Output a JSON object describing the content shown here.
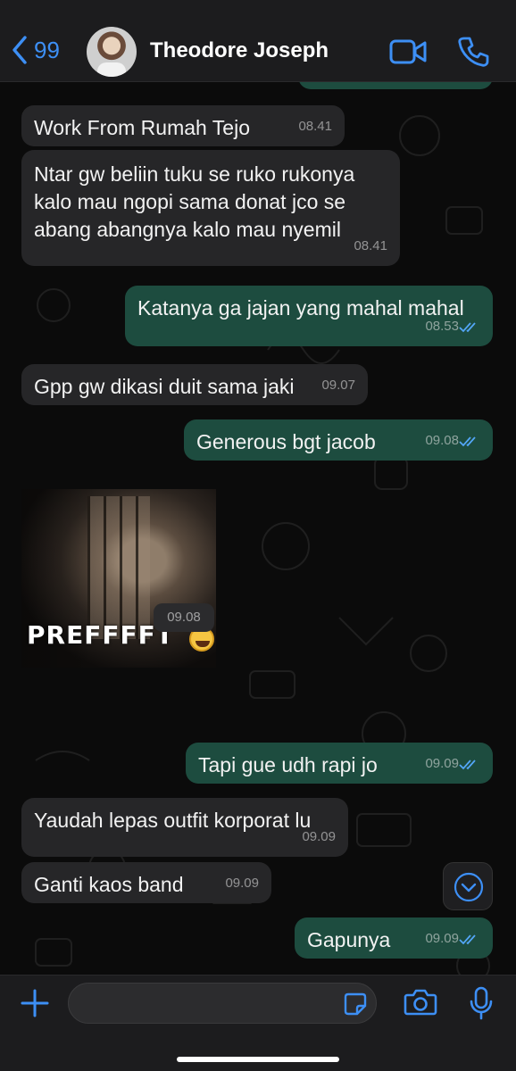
{
  "header": {
    "back_count": "99",
    "contact_name": "Theodore Joseph"
  },
  "messages": [
    {
      "dir": "in",
      "text": "Work From Rumah Tejo",
      "time": "08.41"
    },
    {
      "dir": "in",
      "text": "Ntar gw beliin tuku se ruko rukonya kalo mau ngopi sama donat jco se abang abangnya kalo mau nyemil",
      "time": "08.41"
    },
    {
      "dir": "out",
      "text": "Katanya ga jajan yang mahal mahal",
      "time": "08.53",
      "read": true
    },
    {
      "dir": "in",
      "text": "Gpp gw dikasi duit sama jaki",
      "time": "09.07"
    },
    {
      "dir": "out",
      "text": "Generous bgt jacob",
      "time": "09.08",
      "read": true
    },
    {
      "dir": "in",
      "type": "image",
      "caption": "PREFFFFT",
      "time": "09.08"
    },
    {
      "dir": "out",
      "text": "Tapi gue udh rapi jo",
      "time": "09.09",
      "read": true
    },
    {
      "dir": "in",
      "text": "Yaudah lepas outfit korporat lu",
      "time": "09.09"
    },
    {
      "dir": "in",
      "text": "Ganti kaos band",
      "time": "09.09"
    },
    {
      "dir": "out",
      "text": "Gapunya",
      "time": "09.09",
      "read": true
    }
  ],
  "input": {
    "value": "",
    "placeholder": ""
  },
  "colors": {
    "accent": "#3d8ff5",
    "incoming_bubble": "#262628",
    "outgoing_bubble": "#1d4c3f",
    "read_ticks": "#53a6f7"
  },
  "icons": [
    "chevron-left-icon",
    "video-camera-icon",
    "phone-icon",
    "chevron-down-icon",
    "plus-icon",
    "sticker-icon",
    "camera-icon",
    "microphone-icon"
  ]
}
